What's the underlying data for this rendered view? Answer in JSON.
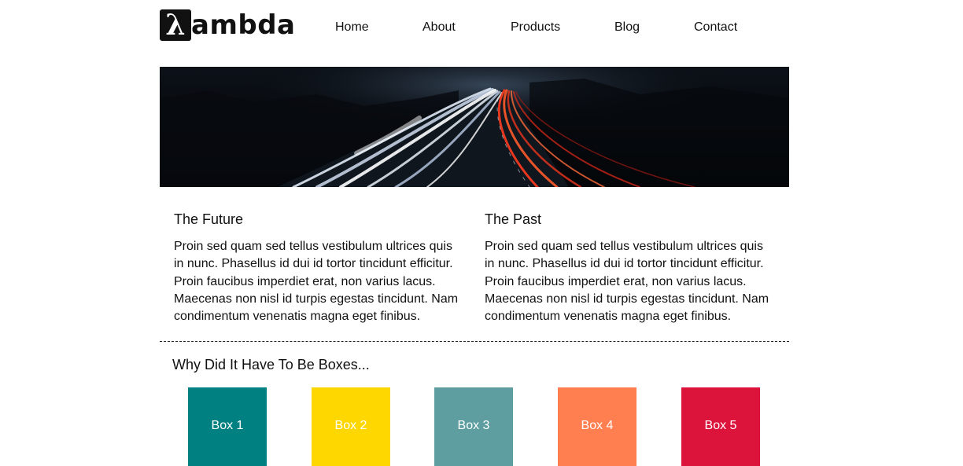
{
  "brand": {
    "logo_mark": "λ",
    "logo_text": "ambda"
  },
  "nav": {
    "items": [
      {
        "label": "Home"
      },
      {
        "label": "About"
      },
      {
        "label": "Products"
      },
      {
        "label": "Blog"
      },
      {
        "label": "Contact"
      }
    ]
  },
  "hero": {
    "image": "highway-light-trails-image"
  },
  "columns": [
    {
      "title": "The Future",
      "body": "Proin sed quam sed tellus vestibulum ultrices quis in nunc. Phasellus id dui id tortor tincidunt efficitur. Proin faucibus imperdiet erat, non varius lacus. Maecenas non nisl id turpis egestas tincidunt. Nam condimentum venenatis magna eget finibus."
    },
    {
      "title": "The Past",
      "body": "Proin sed quam sed tellus vestibulum ultrices quis in nunc. Phasellus id dui id tortor tincidunt efficitur. Proin faucibus imperdiet erat, non varius lacus. Maecenas non nisl id turpis egestas tincidunt. Nam condimentum venenatis magna eget finibus."
    }
  ],
  "boxes_section": {
    "title": "Why Did It Have To Be Boxes...",
    "boxes": [
      {
        "label": "Box 1",
        "color": "#008080"
      },
      {
        "label": "Box 2",
        "color": "#FFD700"
      },
      {
        "label": "Box 3",
        "color": "#5F9EA0"
      },
      {
        "label": "Box 4",
        "color": "#FF7F50"
      },
      {
        "label": "Box 5",
        "color": "#DC143C"
      }
    ]
  }
}
